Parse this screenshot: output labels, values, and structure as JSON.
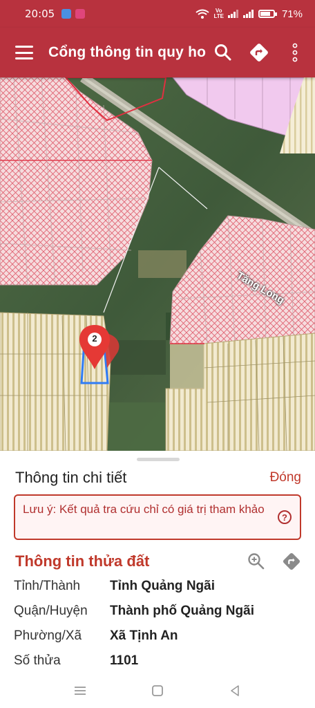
{
  "status": {
    "time": "20:05",
    "network_line1": "Vo",
    "network_line2": "LTE",
    "battery": "71%"
  },
  "appbar": {
    "title": "Cổng thông tin quy hoạch",
    "icons": [
      "menu-icon",
      "search-icon",
      "directions-icon",
      "more-vert-icon"
    ]
  },
  "map": {
    "road_label": "Tăng Long",
    "marker_number": "2",
    "colors": {
      "pink_zone": "#f7dcdf",
      "red_hatch": "#e05060",
      "yellow_zone": "#f3ecc6",
      "yellow_stripe": "#cfc28e",
      "magenta_zone": "#f3c9ef",
      "parcel_outline": "#2f7cf6",
      "marker_red": "#e53935"
    }
  },
  "sheet": {
    "title": "Thông tin chi tiết",
    "close_label": "Đóng",
    "note": "Lưu ý: Kết quả tra cứu chỉ có giá trị tham khảo",
    "parcel_title": "Thông tin thửa đất",
    "rows": [
      {
        "label": "Tỉnh/Thành",
        "value": "Tỉnh Quảng Ngãi"
      },
      {
        "label": "Quận/Huyện",
        "value": "Thành phố Quảng Ngãi"
      },
      {
        "label": "Phường/Xã",
        "value": "Xã Tịnh An"
      },
      {
        "label": "Số thửa",
        "value": "1101"
      }
    ]
  },
  "accent_color": "#b8323e"
}
